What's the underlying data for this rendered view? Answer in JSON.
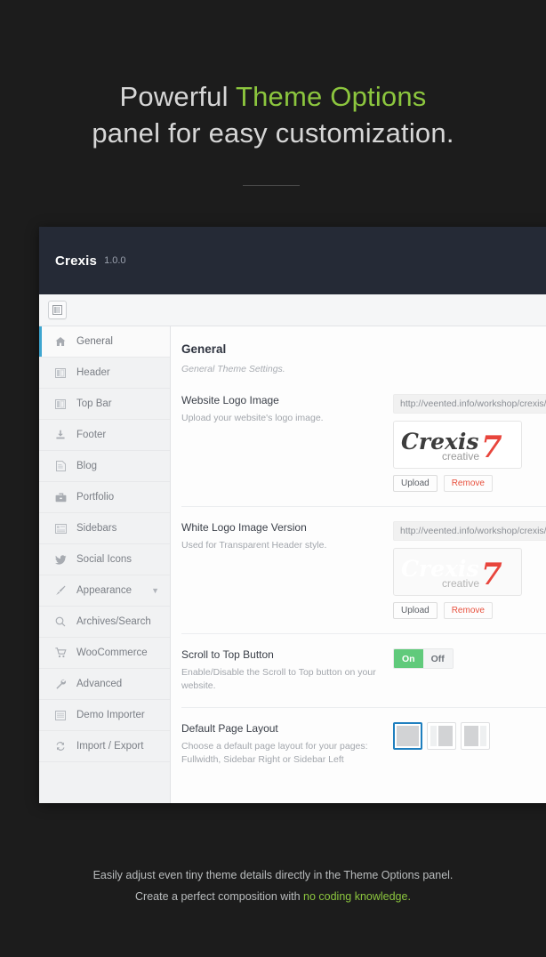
{
  "hero": {
    "line1_prefix": "Powerful ",
    "line1_accent": "Theme Options",
    "line2": "panel for easy customization."
  },
  "panel": {
    "brand": "Crexis",
    "version": "1.0.0",
    "toolbar": {
      "layout_toggle_icon": "panel-layout-icon"
    }
  },
  "sidebar": {
    "items": [
      {
        "label": "General",
        "icon": "home-icon",
        "active": true,
        "caret": ""
      },
      {
        "label": "Header",
        "icon": "columns-icon",
        "active": false,
        "caret": ""
      },
      {
        "label": "Top Bar",
        "icon": "columns-icon",
        "active": false,
        "caret": ""
      },
      {
        "label": "Footer",
        "icon": "download-icon",
        "active": false,
        "caret": ""
      },
      {
        "label": "Blog",
        "icon": "file-icon",
        "active": false,
        "caret": ""
      },
      {
        "label": "Portfolio",
        "icon": "briefcase-icon",
        "active": false,
        "caret": ""
      },
      {
        "label": "Sidebars",
        "icon": "list-icon",
        "active": false,
        "caret": ""
      },
      {
        "label": "Social Icons",
        "icon": "twitter-icon",
        "active": false,
        "caret": ""
      },
      {
        "label": "Appearance",
        "icon": "brush-icon",
        "active": false,
        "caret": "▼"
      },
      {
        "label": "Archives/Search",
        "icon": "search-icon",
        "active": false,
        "caret": ""
      },
      {
        "label": "WooCommerce",
        "icon": "cart-icon",
        "active": false,
        "caret": ""
      },
      {
        "label": "Advanced",
        "icon": "wrench-icon",
        "active": false,
        "caret": ""
      },
      {
        "label": "Demo Importer",
        "icon": "window-icon",
        "active": false,
        "caret": ""
      },
      {
        "label": "Import / Export",
        "icon": "refresh-icon",
        "active": false,
        "caret": ""
      }
    ]
  },
  "content": {
    "section_title": "General",
    "section_subtitle": "General Theme Settings.",
    "fields": [
      {
        "name": "Website Logo Image",
        "desc": "Upload your website's logo image.",
        "url_value": "http://veented.info/workshop/crexis/wp-content/uploads/logo.png",
        "upload_label": "Upload",
        "remove_label": "Remove",
        "logo_text": "Crexis",
        "logo_sub": "creative",
        "logo_numeral": "7"
      },
      {
        "name": "White Logo Image Version",
        "desc": "Used for Transparent Header style.",
        "url_value": "http://veented.info/workshop/crexis/wp-content/uploads/logo-white.png",
        "upload_label": "Upload",
        "remove_label": "Remove",
        "logo_text": "Crexis",
        "logo_sub": "creative",
        "logo_numeral": "7"
      },
      {
        "name": "Scroll to Top Button",
        "desc": "Enable/Disable the Scroll to Top button on your website.",
        "on_label": "On",
        "off_label": "Off",
        "value": "On"
      },
      {
        "name": "Default Page Layout",
        "desc": "Choose a default page layout for your pages: Fullwidth, Sidebar Right or Sidebar Left",
        "options": [
          "Fullwidth",
          "Sidebar Right",
          "Sidebar Left"
        ],
        "selected_index": 0
      }
    ]
  },
  "caption": {
    "line1": "Easily adjust even tiny theme details directly in the Theme Options panel.",
    "line2_prefix": "Create a perfect composition with ",
    "line2_accent": "no coding knowledge."
  },
  "colors": {
    "bg_dark": "#1c1c1c",
    "accent_green": "#8cc63e",
    "panel_header": "#252a36",
    "active_bar": "#3ea6d0",
    "toggle_on": "#60ca7b",
    "danger": "#e8523f",
    "logo_red": "#e8453c",
    "layout_selected": "#1f7fbf"
  }
}
